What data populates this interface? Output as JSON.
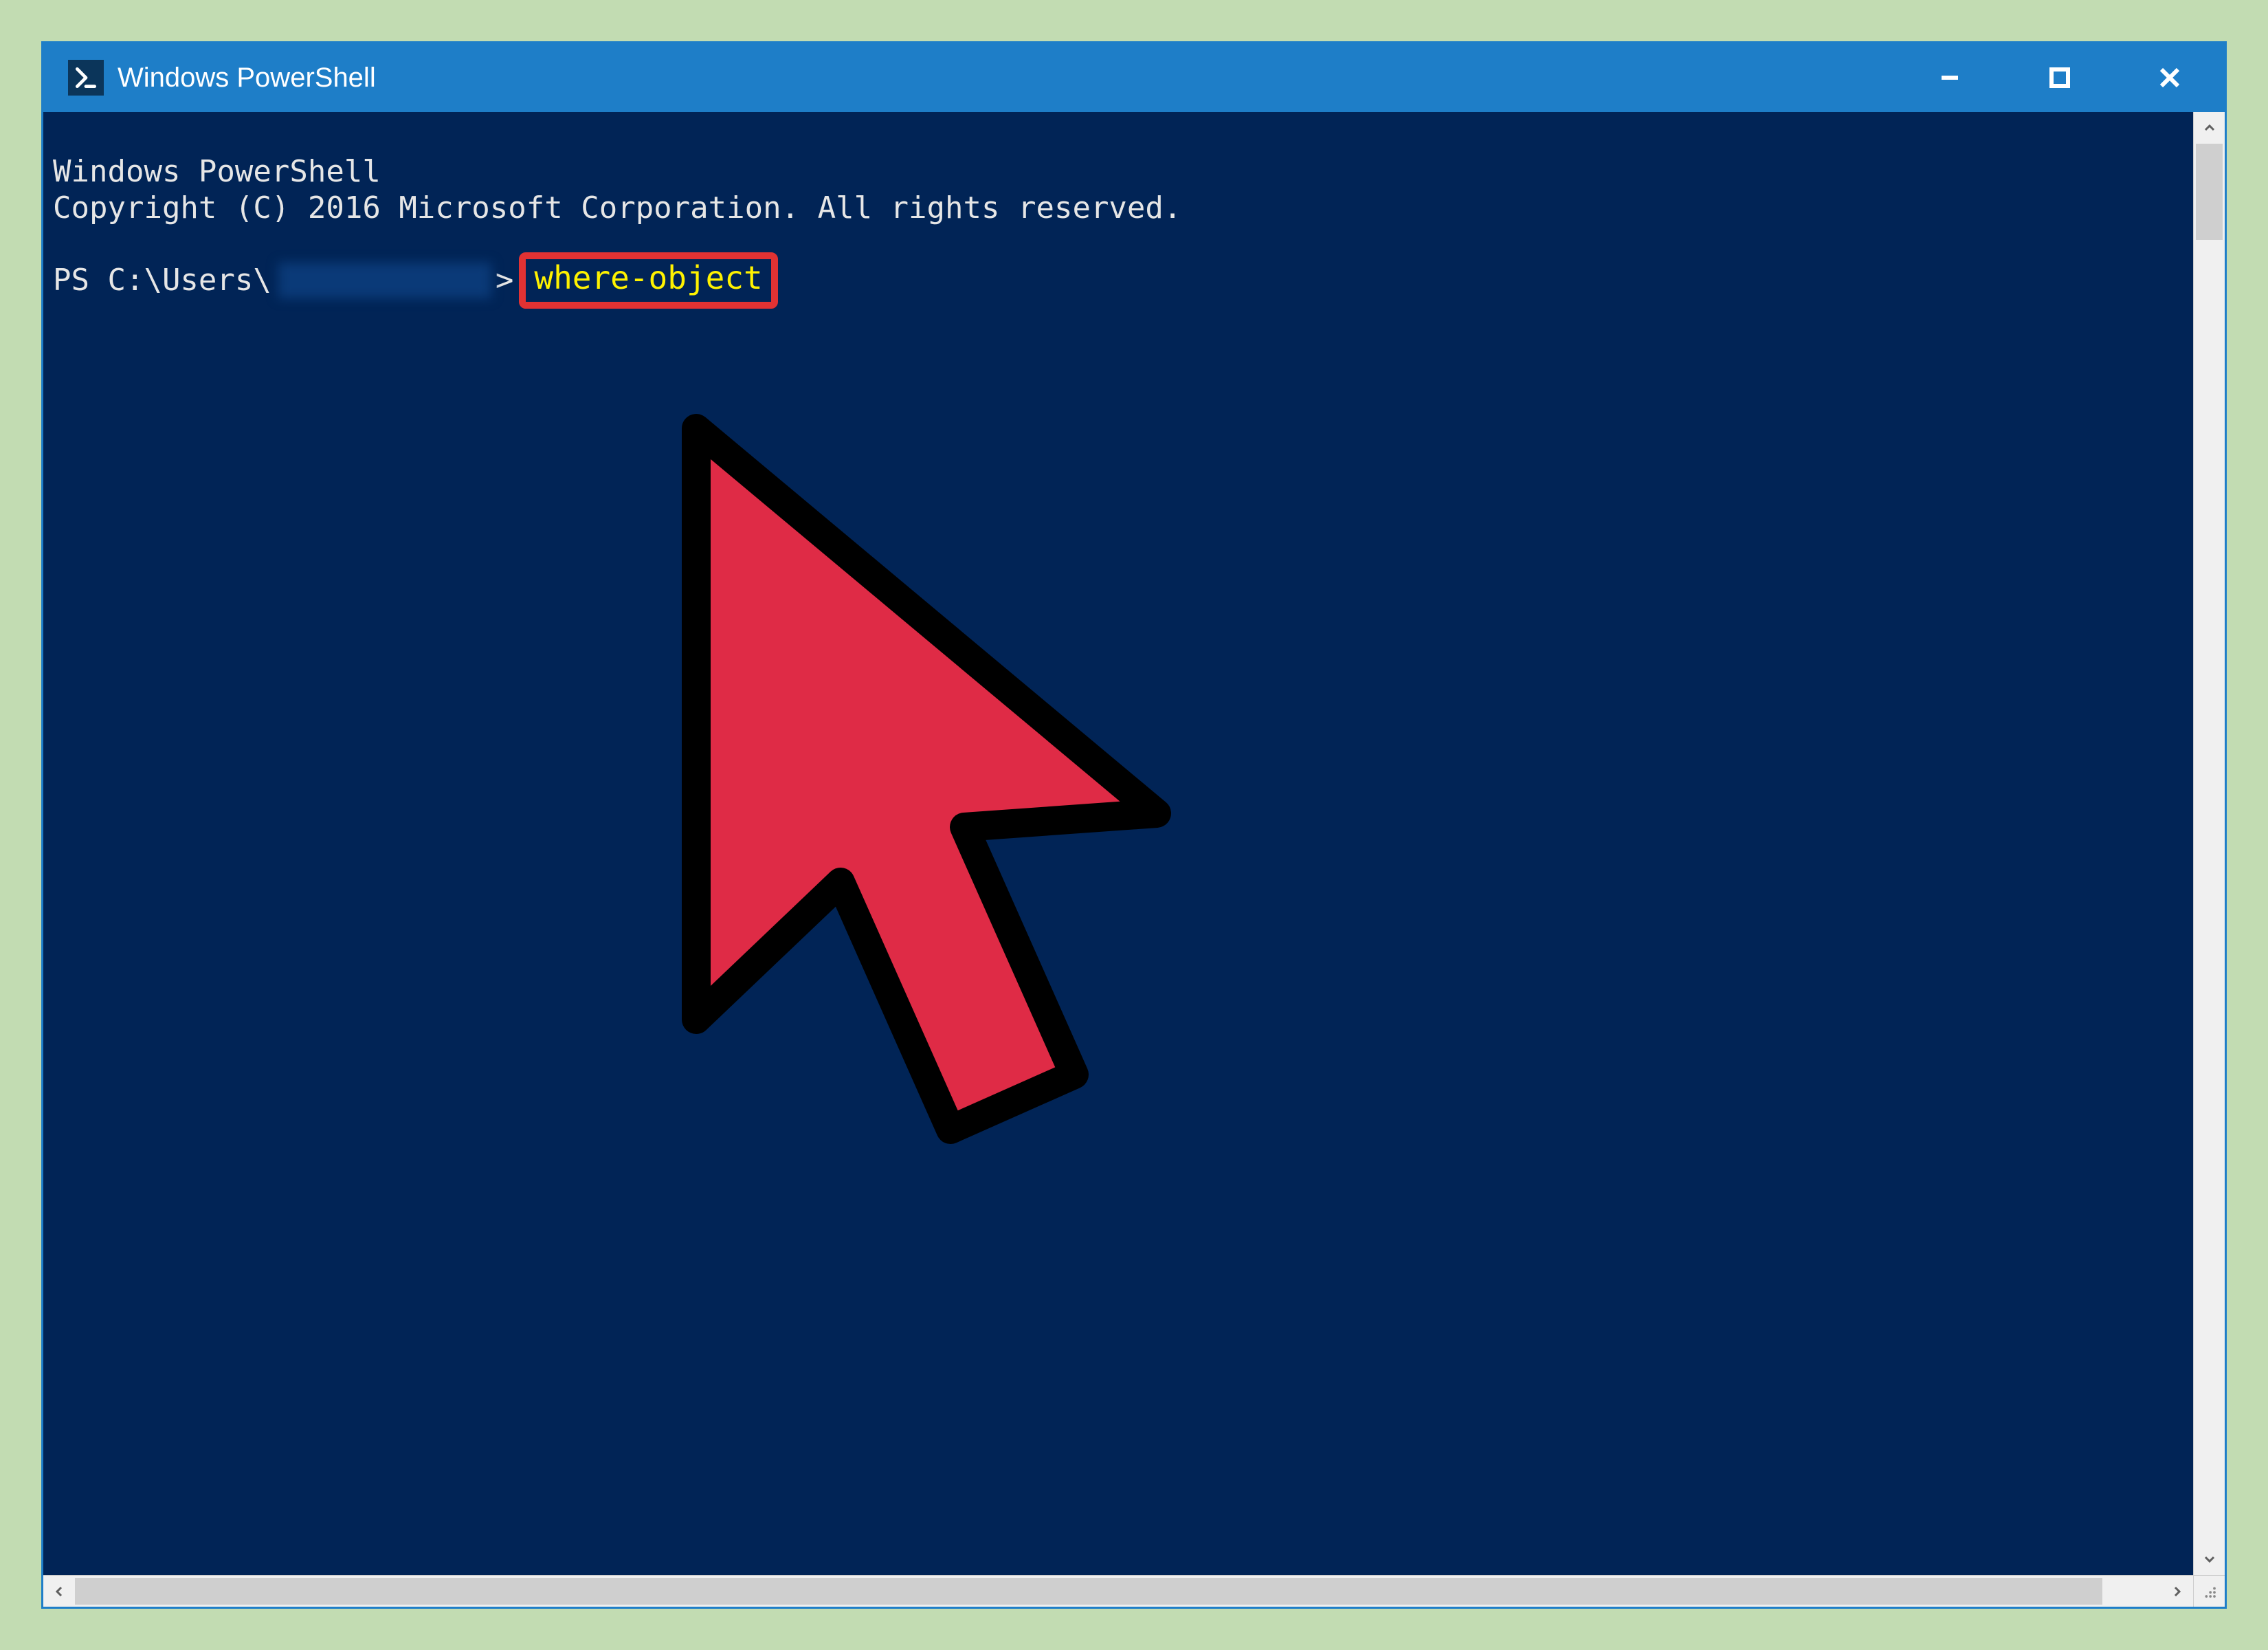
{
  "window": {
    "title": "Windows PowerShell"
  },
  "terminal": {
    "line1": "Windows PowerShell",
    "line2": "Copyright (C) 2016 Microsoft Corporation. All rights reserved.",
    "prompt_prefix": "PS C:\\Users\\",
    "prompt_suffix": ">",
    "command": "where-object"
  },
  "colors": {
    "titlebar": "#1e7ec8",
    "terminal_bg": "#012456",
    "command_highlight": "#fff200",
    "highlight_border": "#e13233",
    "cursor_fill": "#df2b46"
  }
}
